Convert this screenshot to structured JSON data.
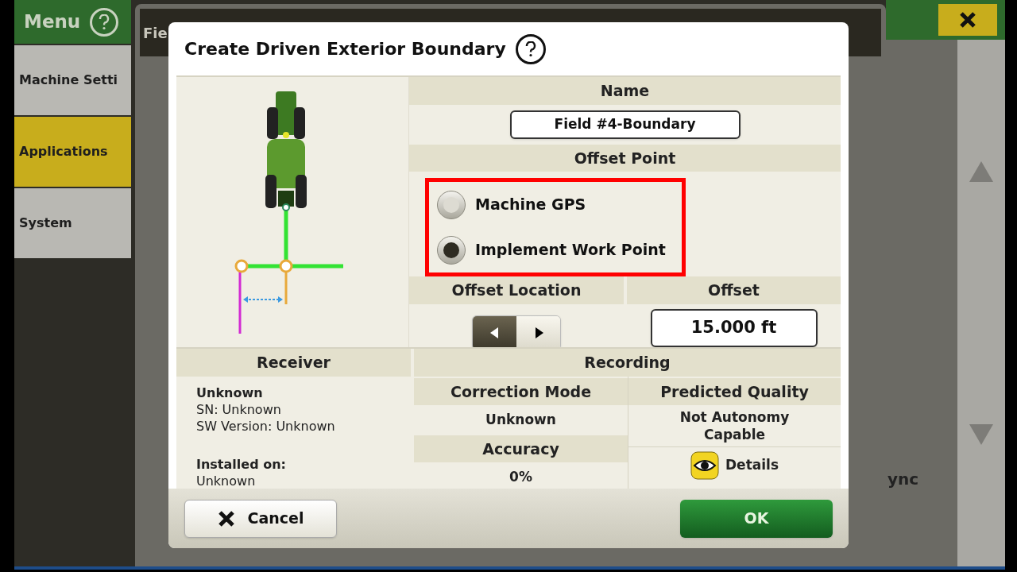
{
  "sidebar": {
    "title": "Menu",
    "items": [
      {
        "label": "Machine Setti",
        "selected": false
      },
      {
        "label": "Applications",
        "selected": true
      },
      {
        "label": "System",
        "selected": false
      }
    ]
  },
  "background": {
    "title": "Fie",
    "side_label": "ync"
  },
  "dialog": {
    "title": "Create Driven Exterior Boundary",
    "name": {
      "header": "Name",
      "value": "Field #4-Boundary"
    },
    "offset_point": {
      "header": "Offset Point",
      "highlighted": true,
      "options": [
        {
          "label": "Machine GPS",
          "selected": false
        },
        {
          "label": "Implement Work Point",
          "selected": true
        }
      ]
    },
    "offset_location": {
      "header": "Offset Location",
      "directions": [
        {
          "kind": "left",
          "selected": true
        },
        {
          "kind": "right",
          "selected": false
        }
      ]
    },
    "offset": {
      "header": "Offset",
      "value": "15.000 ft"
    },
    "receiver": {
      "header": "Receiver",
      "name": "Unknown",
      "serial": "SN: Unknown",
      "software": "SW Version: Unknown",
      "installed_label": "Installed on:",
      "installed_value": "Unknown"
    },
    "recording": {
      "header": "Recording",
      "correction_mode": {
        "header": "Correction Mode",
        "value": "Unknown"
      },
      "accuracy": {
        "header": "Accuracy",
        "value": "0%"
      },
      "predicted_quality": {
        "header": "Predicted Quality",
        "value": "Not Autonomy Capable",
        "details": "Details"
      }
    },
    "buttons": {
      "cancel": "Cancel",
      "ok": "OK"
    }
  }
}
